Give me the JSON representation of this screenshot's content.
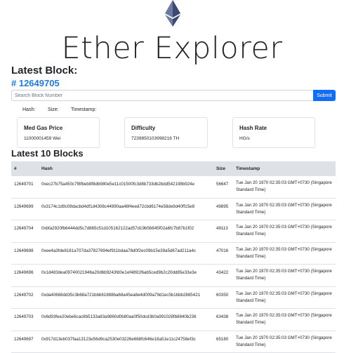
{
  "app": {
    "title": "Ether Explorer",
    "logo_icon": "ethereum-diamond-icon"
  },
  "latest_block": {
    "heading": "Latest Block:",
    "number": "# 12649705"
  },
  "search": {
    "placeholder": "Search Block Number",
    "button_label": "Submit"
  },
  "block_meta": {
    "hash_label": "Hash:",
    "size_label": "Size:",
    "timestamp_label": "Timestamp:"
  },
  "cards": [
    {
      "title": "Med Gas Price",
      "value": "11000001459 Wei"
    },
    {
      "title": "Difficulty",
      "value": "7239850103998216 TH"
    },
    {
      "title": "Hash Rate",
      "value": "HG/s"
    }
  ],
  "blocks": {
    "heading": "Latest 10 Blocks",
    "columns": [
      "#",
      "Hash",
      "Size",
      "Timestamp"
    ],
    "rows": [
      {
        "num": "12649701",
        "hash": "0xec27b75a450c7f8fbeb8f8db980e5e11c01500fc3d8b733db2bdd542198b924e",
        "size": "56647",
        "time": "Tue Jan 20 1970 02:35:03 GMT+0730 (Singapore Standard Time)"
      },
      {
        "num": "12649699",
        "hash": "0x3174c1d9c08dacbd4df1d4308c44990aa48f4eed72cbd6174e58de9d40ff15e8",
        "size": "49895",
        "time": "Tue Jan 20 1970 02:35:03 GMT+0730 (Singapore Standard Time)"
      },
      {
        "num": "12649704",
        "hash": "0xbfa2920fb6444dd5c7d865c51d105162122ad57d19b56845f02a6fc7b87b1f02",
        "size": "49113",
        "time": "Tue Jan 20 1970 02:35:03 GMT+0730 (Singapore Standard Time)"
      },
      {
        "num": "12649698",
        "hash": "0xee4a3fde8181a707da37827694ef911bdaa78d0f2ec09b15e39a5d67ad211a4c",
        "size": "47016",
        "time": "Tue Jan 20 1970 02:35:03 GMT+0730 (Singapore Standard Time)"
      },
      {
        "num": "12649696",
        "hash": "0x1d483dea09740021946a20d6b9243fd0e1ef4891f6ab5ced9b2c20dd85e33e3e",
        "size": "43422",
        "time": "Tue Jan 20 1970 02:35:03 GMT+0730 (Singapore Standard Time)"
      },
      {
        "num": "12649702",
        "hash": "0xda40668dd35c3b68a721bbb61888ba68a45ea8e4d009a79d1ec5b1bbb2885421",
        "size": "60350",
        "time": "Tue Jan 20 1970 02:35:03 GMT+0730 (Singapore Standard Time)"
      },
      {
        "num": "12649703",
        "hash": "0x6d93fee20ebe6cac8b5133a83a9860d0b80aa0f50dcd3b0a991028fb8840b236",
        "size": "63438",
        "time": "Tue Jan 20 1970 02:35:03 GMT+0730 (Singapore Standard Time)"
      },
      {
        "num": "12649697",
        "hash": "0x917d13eb037faa13123e56d9ca2530e03226e668fc646e18a51e11c24758ef3c",
        "size": "65180",
        "time": "Tue Jan 20 1970 02:35:03 GMT+0730 (Singapore Standard Time)"
      }
    ]
  },
  "colors": {
    "accent": "#0d6efd",
    "link": "#1f7ae0",
    "table_header": "#dee2e6",
    "logo": "#5b6b8f"
  }
}
